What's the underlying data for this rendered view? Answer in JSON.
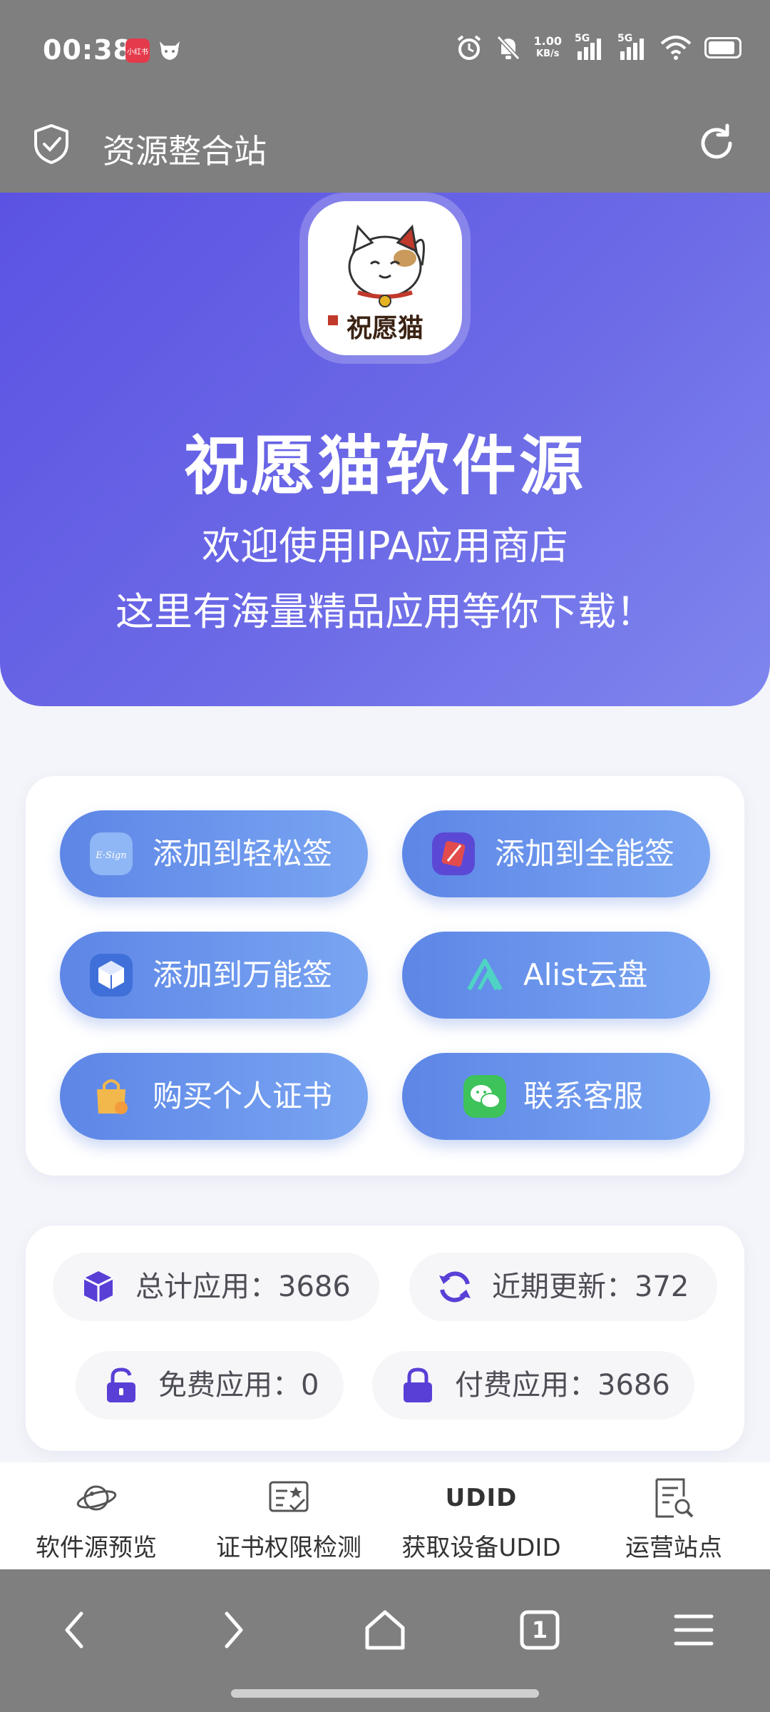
{
  "status_bar": {
    "time": "00:38",
    "badge_text": "小红书",
    "net_speed_value": "1.00",
    "net_speed_unit": "KB/s",
    "network_1": "5G",
    "network_2": "5G"
  },
  "app_bar": {
    "title": "资源整合站"
  },
  "hero": {
    "title": "祝愿猫软件源",
    "subtitle_line1": "欢迎使用IPA应用商店",
    "subtitle_line2": "这里有海量精品应用等你下载！",
    "logo_text": "祝愿猫"
  },
  "actions": [
    {
      "label": "添加到轻松签",
      "icon": "esign-icon"
    },
    {
      "label": "添加到全能签",
      "icon": "quanneng-icon"
    },
    {
      "label": "添加到万能签",
      "icon": "cube-icon"
    },
    {
      "label": "Alist云盘",
      "icon": "alist-icon"
    },
    {
      "label": "购买个人证书",
      "icon": "shopping-bag-icon"
    },
    {
      "label": "联系客服",
      "icon": "wechat-icon"
    }
  ],
  "stats": {
    "total": "总计应用：3686",
    "recent": "近期更新：372",
    "free": "免费应用：0",
    "paid": "付费应用：3686"
  },
  "bottom_tabs": [
    {
      "label": "软件源预览",
      "icon": "planet-icon"
    },
    {
      "label": "证书权限检测",
      "icon": "certificate-icon"
    },
    {
      "label": "获取设备UDID",
      "icon": "udid-icon",
      "icon_text": "UDID"
    },
    {
      "label": "运营站点",
      "icon": "document-search-icon"
    }
  ],
  "nav_bar": {
    "tab_count": "1"
  },
  "colors": {
    "hero_start": "#5b52e3",
    "hero_end": "#7f86ee",
    "button_start": "#5d86e6",
    "button_end": "#79a5f2",
    "accent": "#5a3fd6"
  }
}
